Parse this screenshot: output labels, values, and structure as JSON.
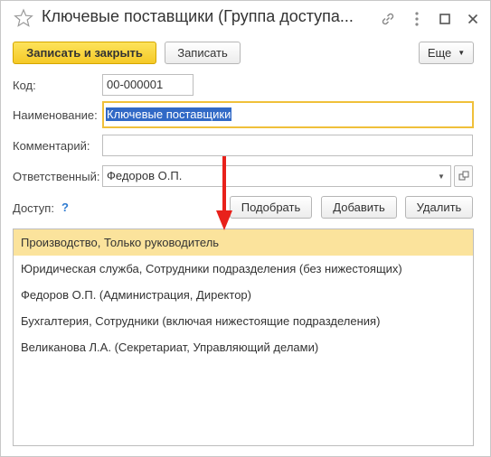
{
  "window": {
    "title": "Ключевые поставщики (Группа доступа...",
    "favorite_icon": "star-icon",
    "controls": [
      "link-icon",
      "more-icon",
      "maximize-icon",
      "close-icon"
    ]
  },
  "toolbar": {
    "save_close_label": "Записать и закрыть",
    "save_label": "Записать",
    "more_label": "Еще"
  },
  "form": {
    "code_label": "Код:",
    "code_value": "00-000001",
    "name_label": "Наименование:",
    "name_value": "Ключевые поставщики",
    "comment_label": "Комментарий:",
    "comment_value": "",
    "responsible_label": "Ответственный:",
    "responsible_value": "Федоров О.П.",
    "access_label": "Доступ:",
    "help_mark": "?"
  },
  "access_toolbar": {
    "pick_label": "Подобрать",
    "add_label": "Добавить",
    "delete_label": "Удалить"
  },
  "access_list": {
    "selected_index": 0,
    "items": [
      "Производство, Только руководитель",
      "Юридическая служба, Сотрудники подразделения (без нижестоящих)",
      "Федоров О.П. (Администрация, Директор)",
      "Бухгалтерия, Сотрудники (включая нижестоящие подразделения)",
      "Великанова Л.А. (Секретариат, Управляющий делами)"
    ]
  },
  "colors": {
    "primary_button": "#f5c927",
    "focus_border": "#f0c03a",
    "selected_row": "#fbe39c",
    "selection": "#3169c6",
    "help": "#2e7bd1",
    "annotation_arrow": "#e8211b"
  }
}
